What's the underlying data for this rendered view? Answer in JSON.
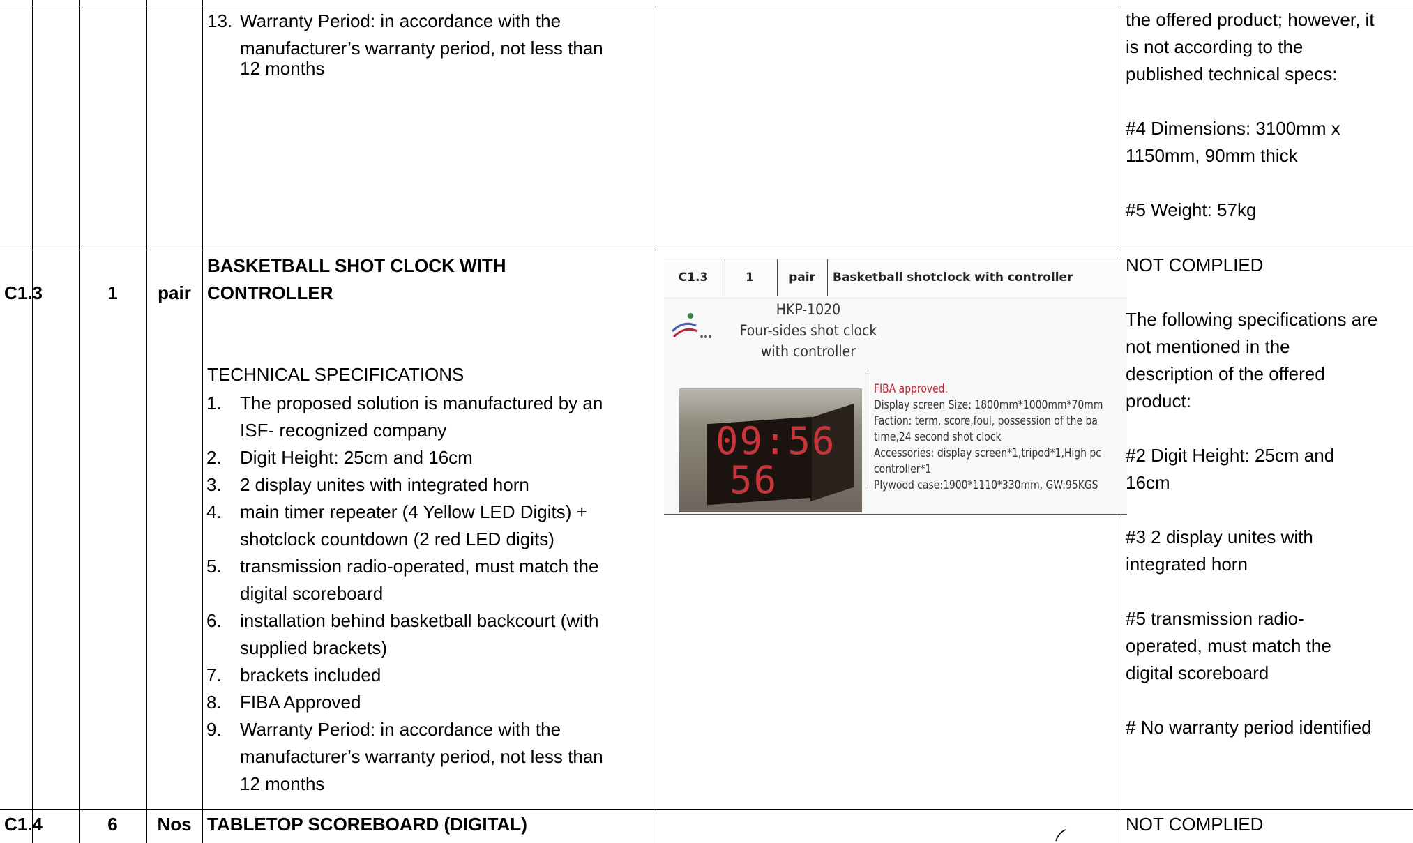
{
  "prev_row": {
    "spec_item": {
      "num": "13.",
      "lines": [
        "Warranty Period: in accordance with the",
        "manufacturer’s warranty period, not less than",
        "12 months"
      ]
    },
    "remarks": "the offered product; however, it\nis not according to the\npublished technical specs:\n\n#4 Dimensions: 3100mm x\n1150mm, 90mm thick\n\n#5 Weight: 57kg"
  },
  "row_c13": {
    "code": "C1.3",
    "qty": "1",
    "unit": "pair",
    "title_line1": "BASKETBALL SHOT CLOCK WITH",
    "title_line2": "CONTROLLER",
    "tech_heading": "TECHNICAL SPECIFICATIONS",
    "specs": [
      {
        "num": "1.",
        "lines": [
          "The proposed solution is manufactured by an",
          "ISF- recognized company"
        ]
      },
      {
        "num": "2.",
        "lines": [
          "Digit Height: 25cm and 16cm"
        ]
      },
      {
        "num": "3.",
        "lines": [
          "2 display unites with integrated horn"
        ]
      },
      {
        "num": "4.",
        "lines": [
          "main timer repeater (4 Yellow LED Digits) +",
          "shotclock countdown (2 red LED digits)"
        ]
      },
      {
        "num": "5.",
        "lines": [
          "transmission radio-operated, must match the",
          "digital scoreboard"
        ]
      },
      {
        "num": "6.",
        "lines": [
          "installation behind basketball backcourt (with",
          "supplied brackets)"
        ]
      },
      {
        "num": "7.",
        "lines": [
          "brackets included"
        ]
      },
      {
        "num": "8.",
        "lines": [
          "FIBA Approved"
        ]
      },
      {
        "num": "9.",
        "lines": [
          "Warranty Period: in accordance with the",
          "manufacturer’s warranty period, not less than",
          "12 months"
        ]
      }
    ],
    "offer": {
      "code": "C1.3",
      "qty": "1",
      "unit": "pair",
      "desc": "Basketball shotclock with controller",
      "model": "HKP-1020",
      "model_desc1": "Four-sides shot clock",
      "model_desc2": "with controller",
      "fiba": "FIBA approved.",
      "spec_lines": [
        "Display screen Size: 1800mm*1000mm*70mm",
        "Faction: term, score,foul, possession of the ba",
        "time,24 second shot clock",
        "Accessories: display screen*1,tripod*1,High pc",
        "controller*1",
        "Plywood case:1900*1110*330mm, GW:95KGS"
      ],
      "photo_digits1": "09:56",
      "photo_digits2": "56"
    },
    "remarks": "NOT COMPLIED\n\nThe following specifications are\nnot mentioned in the\ndescription of the offered\nproduct:\n\n#2 Digit Height: 25cm and\n16cm\n\n#3 2 display unites with\nintegrated horn\n\n#5 transmission radio-\noperated, must match the\ndigital scoreboard\n\n# No warranty period identified"
  },
  "row_c14": {
    "code": "C1.4",
    "qty": "6",
    "unit": "Nos",
    "title": "TABLETOP SCOREBOARD (DIGITAL)",
    "remarks": "NOT COMPLIED"
  },
  "colors": {
    "rule": "#000000",
    "scan_red": "#c0243a"
  }
}
